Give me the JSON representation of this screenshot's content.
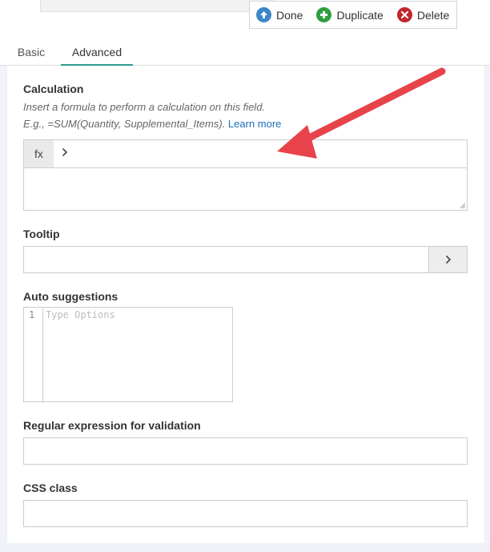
{
  "toolbar": {
    "done_label": "Done",
    "duplicate_label": "Duplicate",
    "delete_label": "Delete"
  },
  "tabs": [
    {
      "label": "Basic",
      "active": false
    },
    {
      "label": "Advanced",
      "active": true
    }
  ],
  "calculation": {
    "label": "Calculation",
    "help_line1": "Insert a formula to perform a calculation on this field.",
    "help_line2": "E.g., =SUM(Quantity, Supplemental_Items).",
    "learn_more": "Learn more",
    "fx_label": "fx"
  },
  "tooltip": {
    "label": "Tooltip"
  },
  "auto_suggestions": {
    "label": "Auto suggestions",
    "line_number": "1",
    "placeholder": "Type Options"
  },
  "regex": {
    "label": "Regular expression for validation"
  },
  "css_class": {
    "label": "CSS class"
  },
  "colors": {
    "accent_tab": "#2a9d8f",
    "done_icon": "#3a87c8",
    "duplicate_icon": "#2e9e3e",
    "delete_icon": "#c0272d",
    "arrow": "#e8434b",
    "link": "#1d6fb8"
  }
}
